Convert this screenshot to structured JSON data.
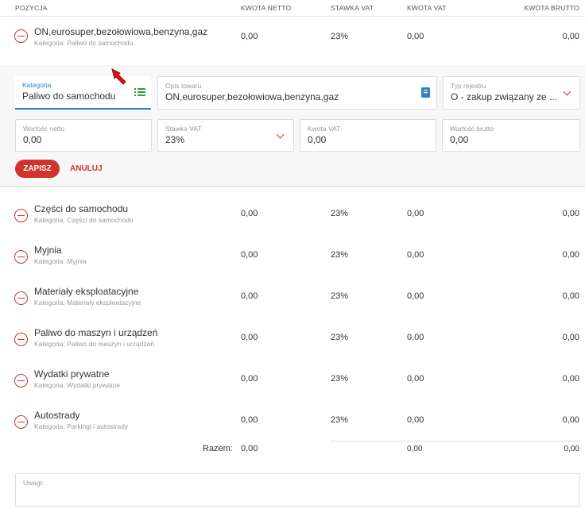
{
  "columns": {
    "pozycja": "POZYCJA",
    "netto": "KWOTA NETTO",
    "stawka": "STAWKA VAT",
    "vat": "KWOTA VAT",
    "brutto": "KWOTA BRUTTO"
  },
  "top_row": {
    "name": "ON,eurosuper,bezołowiowa,benzyna,gaz",
    "category": "Kategoria: Paliwo do samochodu",
    "netto": "0,00",
    "stawka": "23%",
    "vat": "0,00",
    "brutto": "0,00"
  },
  "editor": {
    "kategoria": {
      "label": "Kategoria",
      "value": "Paliwo do samochodu",
      "icon": "list-icon"
    },
    "opis": {
      "label": "Opis towaru",
      "value": "ON,eurosuper,bezołowiowa,benzyna,gaz",
      "icon": "book-icon"
    },
    "typ": {
      "label": "Typ rejestru",
      "value": "O - zakup związany ze ..."
    },
    "netto": {
      "label": "Wartość netto",
      "value": "0,00"
    },
    "stawka": {
      "label": "Stawka VAT",
      "value": "23%"
    },
    "kwota_vat": {
      "label": "Kwota VAT",
      "value": "0,00"
    },
    "brutto": {
      "label": "Wartość brutto",
      "value": "0,00"
    },
    "save_label": "ZAPISZ",
    "cancel_label": "ANULUJ",
    "colors": {
      "accent": "#d0342c",
      "focus": "#2f80c4",
      "list_icon": "#2e9e3e",
      "book_icon": "#2f80c4",
      "arrow": "#e01010"
    }
  },
  "rows": [
    {
      "name": "Części do samochodu",
      "category": "Kategoria: Części do samochodu",
      "netto": "0,00",
      "stawka": "23%",
      "vat": "0,00",
      "brutto": "0,00"
    },
    {
      "name": "Myjnia",
      "category": "Kategoria: Myjnia",
      "netto": "0,00",
      "stawka": "23%",
      "vat": "0,00",
      "brutto": "0,00"
    },
    {
      "name": "Materiały eksploatacyjne",
      "category": "Kategoria: Materiały eksploatacyjne",
      "netto": "0,00",
      "stawka": "23%",
      "vat": "0,00",
      "brutto": "0,00"
    },
    {
      "name": "Paliwo do maszyn i urządzeń",
      "category": "Kategoria: Paliwo do maszyn i urządzeń",
      "netto": "0,00",
      "stawka": "23%",
      "vat": "0,00",
      "brutto": "0,00"
    },
    {
      "name": "Wydatki prywatne",
      "category": "Kategoria: Wydatki prywatne",
      "netto": "0,00",
      "stawka": "23%",
      "vat": "0,00",
      "brutto": "0,00"
    },
    {
      "name": "Autostrady",
      "category": "Kategoria: Parkingi i autostrady",
      "netto": "0,00",
      "stawka": "23%",
      "vat": "0,00",
      "brutto": "0,00"
    }
  ],
  "totals": {
    "label": "Razem:",
    "netto": "0,00",
    "vat": "0,00",
    "brutto": "0,00"
  },
  "notes": {
    "label": "Uwagi:"
  }
}
